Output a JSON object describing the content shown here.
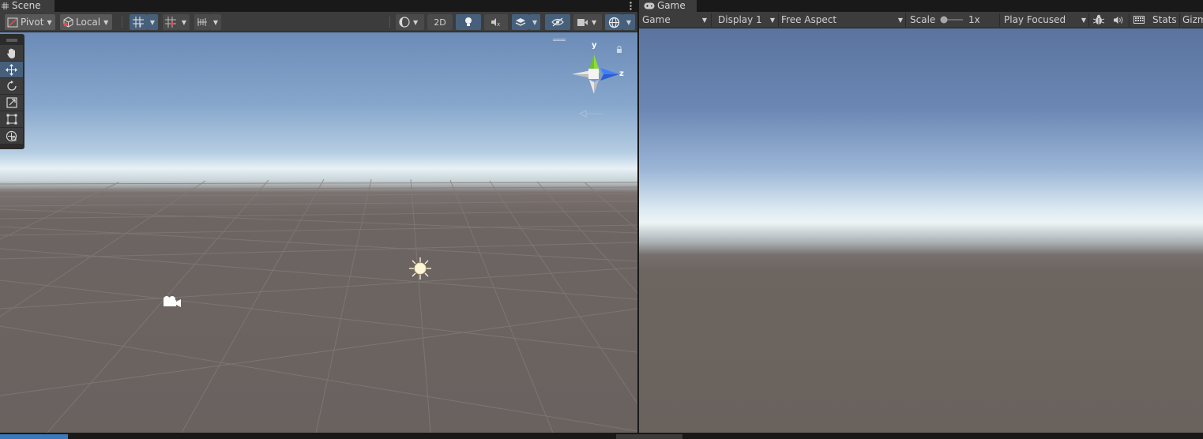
{
  "scene": {
    "tab_title": "Scene",
    "toolbar": {
      "pivot_label": "Pivot",
      "local_label": "Local",
      "mode_2d_label": "2D"
    },
    "gizmo": {
      "y_label": "y",
      "z_label": "z"
    },
    "tools": [
      "hand-tool",
      "move-tool",
      "rotate-tool",
      "scale-tool",
      "rect-tool",
      "transform-tool"
    ],
    "active_tool": "move-tool"
  },
  "game": {
    "tab_title": "Game",
    "toolbar": {
      "view_dropdown": "Game",
      "display_dropdown": "Display 1",
      "aspect_dropdown": "Free Aspect",
      "scale_label": "Scale",
      "scale_value": "1x",
      "play_mode_dropdown": "Play Focused",
      "stats_label": "Stats",
      "gizmos_label": "Gizm"
    }
  },
  "colors": {
    "accent_blue": "#46607c",
    "panel_bg": "#3c3c3c",
    "gizmo_y": "#8fdb3a",
    "gizmo_z": "#3f7fff"
  }
}
